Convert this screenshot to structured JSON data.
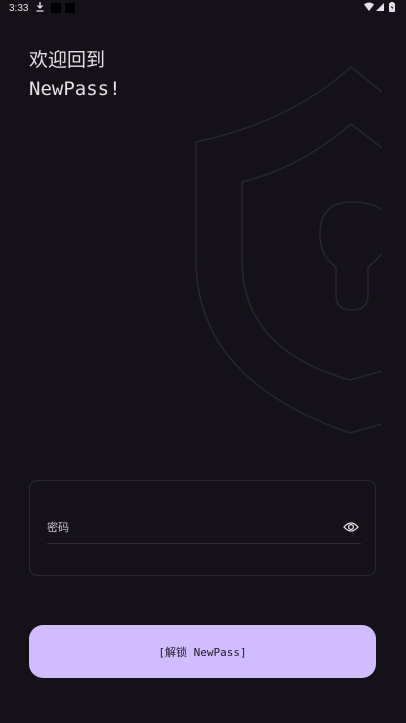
{
  "status_bar": {
    "time": "3:33",
    "icons": [
      "download-icon",
      "notification-icon",
      "notification-icon",
      "wifi-icon",
      "signal-icon",
      "battery-icon"
    ]
  },
  "greeting": {
    "line1": "欢迎回到",
    "line2": "NewPass!"
  },
  "password_field": {
    "label": "密码",
    "visibility_icon": "eye-icon"
  },
  "unlock_button": {
    "label": "[解锁 NewPass]"
  },
  "background_icon": "shield-keyhole-icon",
  "colors": {
    "background": "#141218",
    "primary": "#d0bcff",
    "on_primary": "#1d1b20",
    "text": "#e6e0e9",
    "outline": "#2c2932"
  }
}
